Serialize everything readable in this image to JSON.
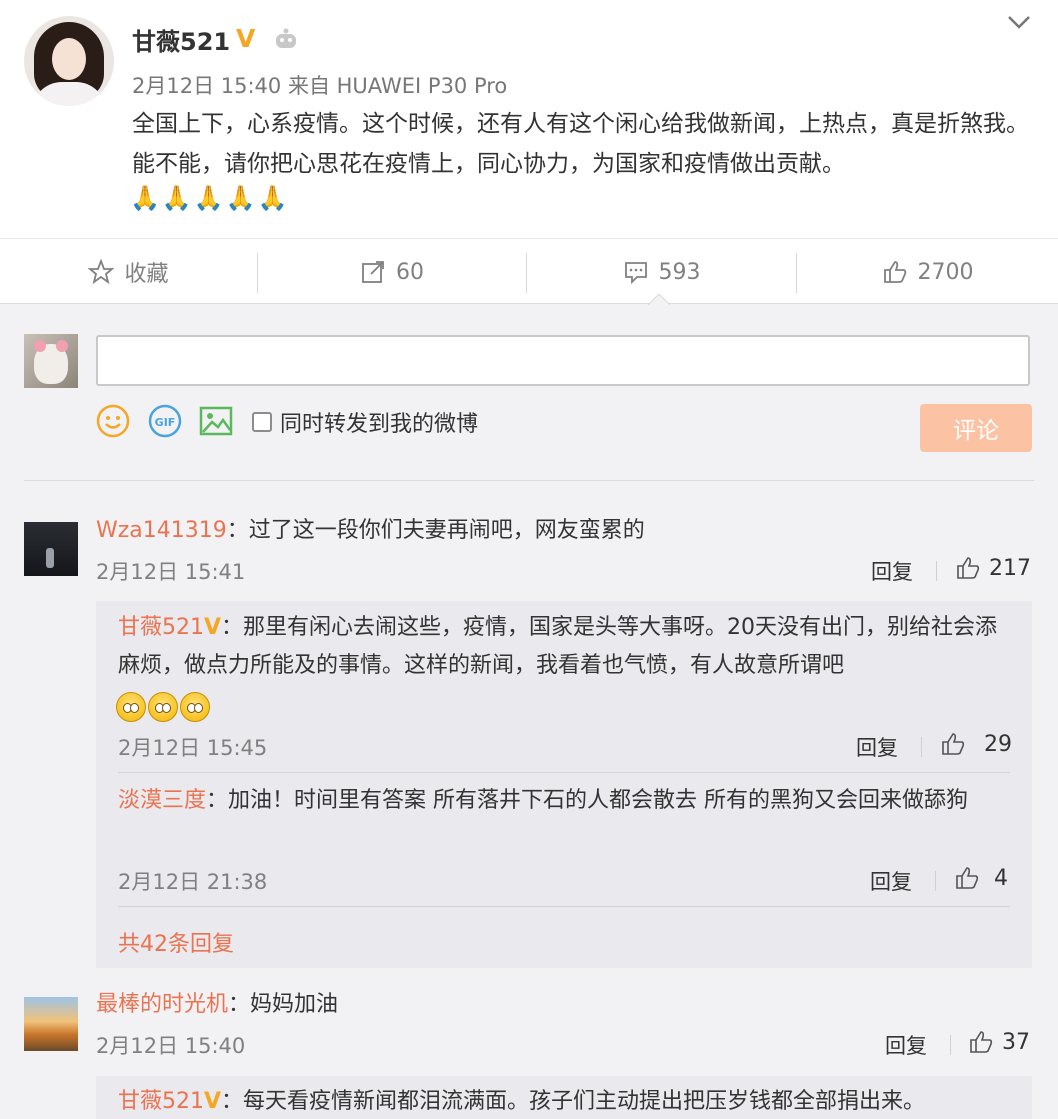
{
  "post": {
    "username": "甘薇521",
    "verified_badge": "V",
    "timestamp": "2月12日 15:40 来自 HUAWEI P30 Pro",
    "content": "全国上下，心系疫情。这个时候，还有人有这个闲心给我做新闻，上热点，真是折煞我。能不能，请你把心思花在疫情上，同心协力，为国家和疫情做出贡献。",
    "emoji": "🙏🙏🙏🙏🙏"
  },
  "actions": {
    "favorite_label": "收藏",
    "repost_count": "60",
    "comment_count": "593",
    "like_count": "2700"
  },
  "composer": {
    "input_value": "",
    "forward_label": "同时转发到我的微博",
    "submit_label": "评论"
  },
  "comments": [
    {
      "user": "Wza141319",
      "text": "：过了这一段你们夫妻再闹吧，网友蛮累的",
      "time": "2月12日 15:41",
      "reply_label": "回复",
      "likes": "217",
      "replies": [
        {
          "user": "甘薇521",
          "badge": "V",
          "text": "：那里有闲心去闹这些，疫情，国家是头等大事呀。20天没有出门，别给社会添麻烦，做点力所能及的事情。这样的新闻，我看着也气愤，有人故意所谓吧",
          "time": "2月12日 15:45",
          "reply_label": "回复",
          "likes": "29"
        },
        {
          "user": "淡漠三度",
          "text": "：加油！时间里有答案 所有落井下石的人都会散去 所有的黑狗又会回来做舔狗",
          "time": "2月12日 21:38",
          "reply_label": "回复",
          "likes": "4"
        }
      ],
      "more_replies": "共42条回复"
    },
    {
      "user": "最棒的时光机",
      "text": "：妈妈加油",
      "time": "2月12日 15:40",
      "reply_label": "回复",
      "likes": "37",
      "replies": [
        {
          "user": "甘薇521",
          "badge": "V",
          "text": "：每天看疫情新闻都泪流满面。孩子们主动提出把压岁钱都全部捐出来。"
        }
      ]
    }
  ],
  "colors": {
    "name_link": "#eb7350",
    "verified": "#f5a623",
    "submit_disabled": "#fbc3a4"
  }
}
